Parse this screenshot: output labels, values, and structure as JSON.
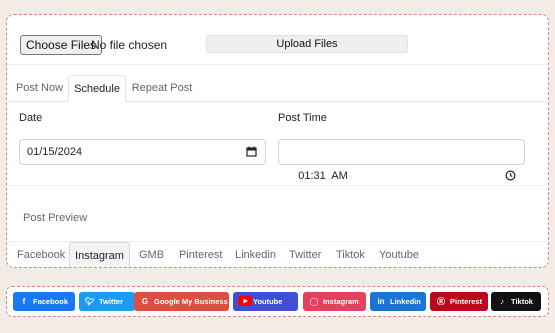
{
  "upload": {
    "choose_label": "Choose Files",
    "status": "No file chosen",
    "upload_label": "Upload Files"
  },
  "post_tabs": [
    "Post Now",
    "Schedule",
    "Repeat Post"
  ],
  "active_post_tab": "Schedule",
  "date": {
    "label": "Date",
    "value": "01/15/2024",
    "icon": "calendar-icon"
  },
  "post_time": {
    "label": "Post Time",
    "value": "01:31  AM",
    "icon": "clock-icon"
  },
  "preview": {
    "label": "Post Preview"
  },
  "platform_tabs": [
    "Facebook",
    "Instagram",
    "GMB",
    "Pinterest",
    "Linkedin",
    "Twitter",
    "Tiktok",
    "Youtube"
  ],
  "active_platform_tab": "Instagram",
  "social_buttons": [
    {
      "label": "Facebook",
      "icon": "facebook-icon",
      "color": "#1877f2"
    },
    {
      "label": "Twitter",
      "icon": "twitter-icon",
      "color": "#1d9bf0"
    },
    {
      "label": "Google My Business",
      "icon": "google-icon",
      "color": "#dc4e41"
    },
    {
      "label": "Youtube",
      "icon": "youtube-icon",
      "color": "#3f4fd6"
    },
    {
      "label": "Instagram",
      "icon": "instagram-icon",
      "color": "#e4405f"
    },
    {
      "label": "Linkedin",
      "icon": "linkedin-icon",
      "color": "#1a74d6"
    },
    {
      "label": "Pinterest",
      "icon": "pinterest-icon",
      "color": "#bd081c"
    },
    {
      "label": "Tiktok",
      "icon": "tiktok-icon",
      "color": "#111111"
    }
  ]
}
